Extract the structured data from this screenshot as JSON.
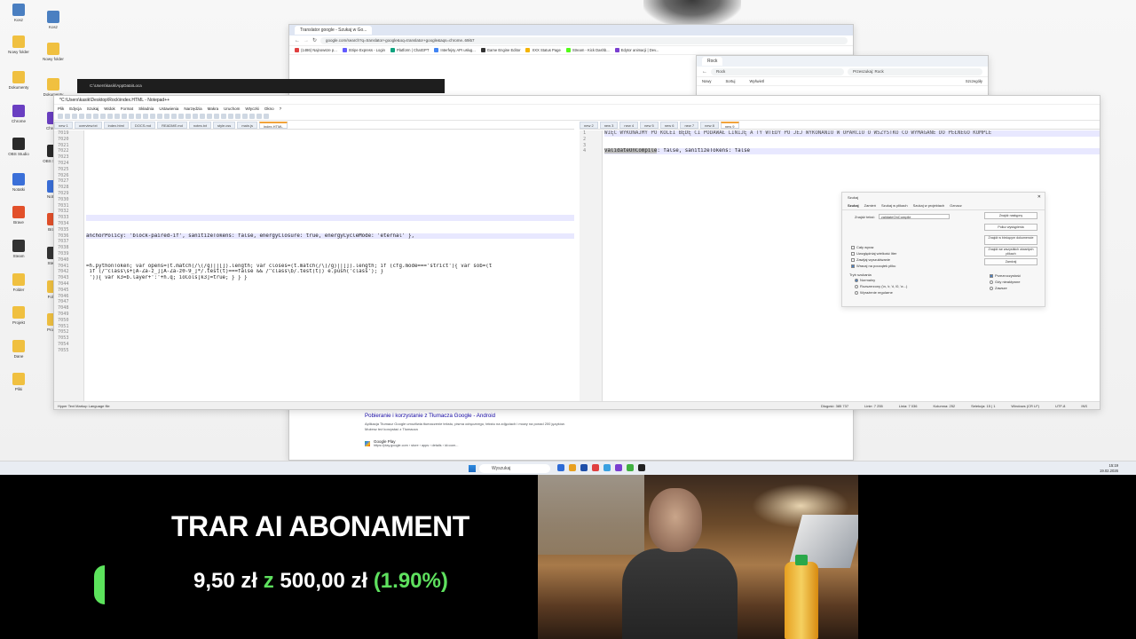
{
  "desktop_icons": [
    {
      "label": "Kosz",
      "color": "#4a7fc1"
    },
    {
      "label": "Nowy folder",
      "color": "#f0c040"
    },
    {
      "label": "Dokumenty",
      "color": "#f0c040"
    },
    {
      "label": "Chrome",
      "color": "#6a3fc2"
    },
    {
      "label": "OBS Studio",
      "color": "#2a2a2a"
    },
    {
      "label": "Notatki",
      "color": "#3a6fd8"
    },
    {
      "label": "Brave",
      "color": "#e2502a"
    },
    {
      "label": "Steam",
      "color": "#333333"
    },
    {
      "label": "Folder",
      "color": "#f0c040"
    },
    {
      "label": "Projekt",
      "color": "#f0c040"
    },
    {
      "label": "Dane",
      "color": "#f0c040"
    },
    {
      "label": "Pliki",
      "color": "#f0c040"
    }
  ],
  "browser_back": {
    "tab_label": "Translator google - Szukaj w Go...",
    "url": "google.com/search?q=translator+google&oq=translator+google&aqs=chrome..69i57",
    "bookmarks": [
      "(1486) Najnowsze p...",
      "Stripe Express - Login",
      "Platform | ChatGPT",
      "Interfejsy API usług...",
      "Game Engine Editor",
      "XXX Status Page",
      "Stream - Kick Dashb...",
      "Edytor animacji | Dev..."
    ],
    "result_title": "Pobieranie i korzystanie z Tłumacza Google - Android",
    "result_snippet": "Aplikacja Tłumacz Google umożliwia tłumaczenie tekstu, pisma odręcznego, tekstu na zdjęciach i mowy na ponad 200 języków. Możesz też korzystać z Tłumacza",
    "result_source": "Google Play",
    "result_url": "https://play.google.com › store › apps › details › id=com..."
  },
  "explorer": {
    "tab_label": "Rock",
    "path": "Rock",
    "search_placeholder": "Przeszukaj: Rock",
    "new_label": "Nowy",
    "sort_label": "Sortuj",
    "view_label": "Wyświetl",
    "details_label": "Szczegóły"
  },
  "npp": {
    "title": "*C:\\Users\\kasik\\Desktop\\Rock\\index.HTML - Notepad++",
    "menu": [
      "Plik",
      "Edycja",
      "Szukaj",
      "Widok",
      "Format",
      "Składnia",
      "Ustawienia",
      "Narzędzia",
      "Makra",
      "Uruchom",
      "Wtyczki",
      "Okno",
      "?"
    ],
    "left_tabs": [
      "new 1",
      "overview.txt",
      "index.html",
      "DOCS.md",
      "README.md",
      "notes.txt",
      "style.css",
      "main.js",
      "index.HTML"
    ],
    "right_tabs": [
      "new 2",
      "new 3",
      "new 4",
      "new 5",
      "new 6",
      "new 7",
      "new 8",
      "new 9"
    ],
    "left_line_numbers": [
      "7019",
      "7020",
      "7021",
      "7022",
      "7023",
      "7024",
      "7025",
      "7026",
      "7027",
      "7028",
      "7029",
      "7030",
      "7031",
      "7032",
      "7033",
      "7034",
      "7035",
      "7036",
      "7037",
      "7038",
      "7039",
      "7040",
      "7041",
      "7042",
      "7043",
      "7044",
      "7045",
      "7046",
      "7047",
      "7048",
      "7049",
      "7050",
      "7051",
      "7052",
      "7053",
      "7054",
      "7055"
    ],
    "left_code_line_36": "anchorPolicy: 'block-paired-if', sanitizeTokens: false, energyClosure: true, energyCycleMode: 'eternal' },",
    "left_code_line_41": "=h.pythonToken; var opens=(t.match(/\\(/g)||[]).length; var closes=(t.match(/\\)/g)||[]).length; if (cfg.mode==='strict'){ var sob=(t",
    "left_code_line_42": " if (/^class\\s+[A-Za-z_][A-Za-z0-9_]*/.test(t)===false && /^class\\b/.test(t)) e.push('class'); }",
    "left_code_line_43": " ')){ var k3=b.layer+':'+h.q; ioCols[k3]=true; } } }",
    "right_line_numbers": [
      "1",
      "2",
      "3",
      "4"
    ],
    "right_line_1": "WIĘC WYKONAJMY PO KOLEI BĘDĘ CI PODAWAŁ LINIJĘ A TY WTEDY PO JEJ WYKONANIU W OPARCIU O WSZYSTKO CO WYMAGANE DO PEŁNEGO KOMPLE",
    "right_line_4_sel": "validateOnCompile",
    "right_line_4_rest": ": false, sanitizeTokens: false",
    "status_left": "Hyper Text Markup Language file",
    "status_right": [
      "Długość: 385 737",
      "Linie: 7 255",
      "Linia: 7 036",
      "Kolumna: 252",
      "Selekcja: 15 | 1",
      "Windows (CR LF)",
      "UTF-8",
      "INS"
    ]
  },
  "find_dialog": {
    "title": "Szukaj",
    "tabs": [
      "Szukaj",
      "Zamień",
      "Szukaj w plikach",
      "Szukaj w projektach",
      "Oznacz"
    ],
    "find_label": "Znajdź tekst:",
    "find_value": "validateOnCompile",
    "buttons": [
      "Znajdź następny",
      "Policz wystąpienia",
      "Znajdź w bieżącym dokumencie",
      "Znajdź we wszystkich otwartych plikach",
      "Zamknij"
    ],
    "options": [
      "Cały wyraz",
      "Uwzględniaj wielkość liter",
      "Zawijaj wyszukiwanie",
      "Wracaj na początek pliku"
    ],
    "mode_title": "Tryb szukania",
    "modes": [
      "Normalny",
      "Rozszerzony (\\n, \\r, \\t, \\0, \\x...)",
      "Wyrażenie regularne"
    ],
    "transparency": "Przezroczystość",
    "on_focus": "Gdy nieaktywne",
    "always": "Zawsze"
  },
  "taskbar": {
    "search_placeholder": "Wyszukaj",
    "time": "15:19",
    "date": "19.02.2026",
    "icon_colors": [
      "#2d6bd6",
      "#e8a020",
      "#1f4fa8",
      "#e04040",
      "#3aa0e0",
      "#7a3fd0",
      "#40b040",
      "#222222"
    ]
  },
  "overlay": {
    "title": "TRAR AI ABONAMENT",
    "current": "9,50 zł",
    "connector": "z",
    "goal": "500,00 zł",
    "percent": "(1.90%)",
    "progress_fraction": 0.019,
    "accent": "#5ee05e"
  }
}
